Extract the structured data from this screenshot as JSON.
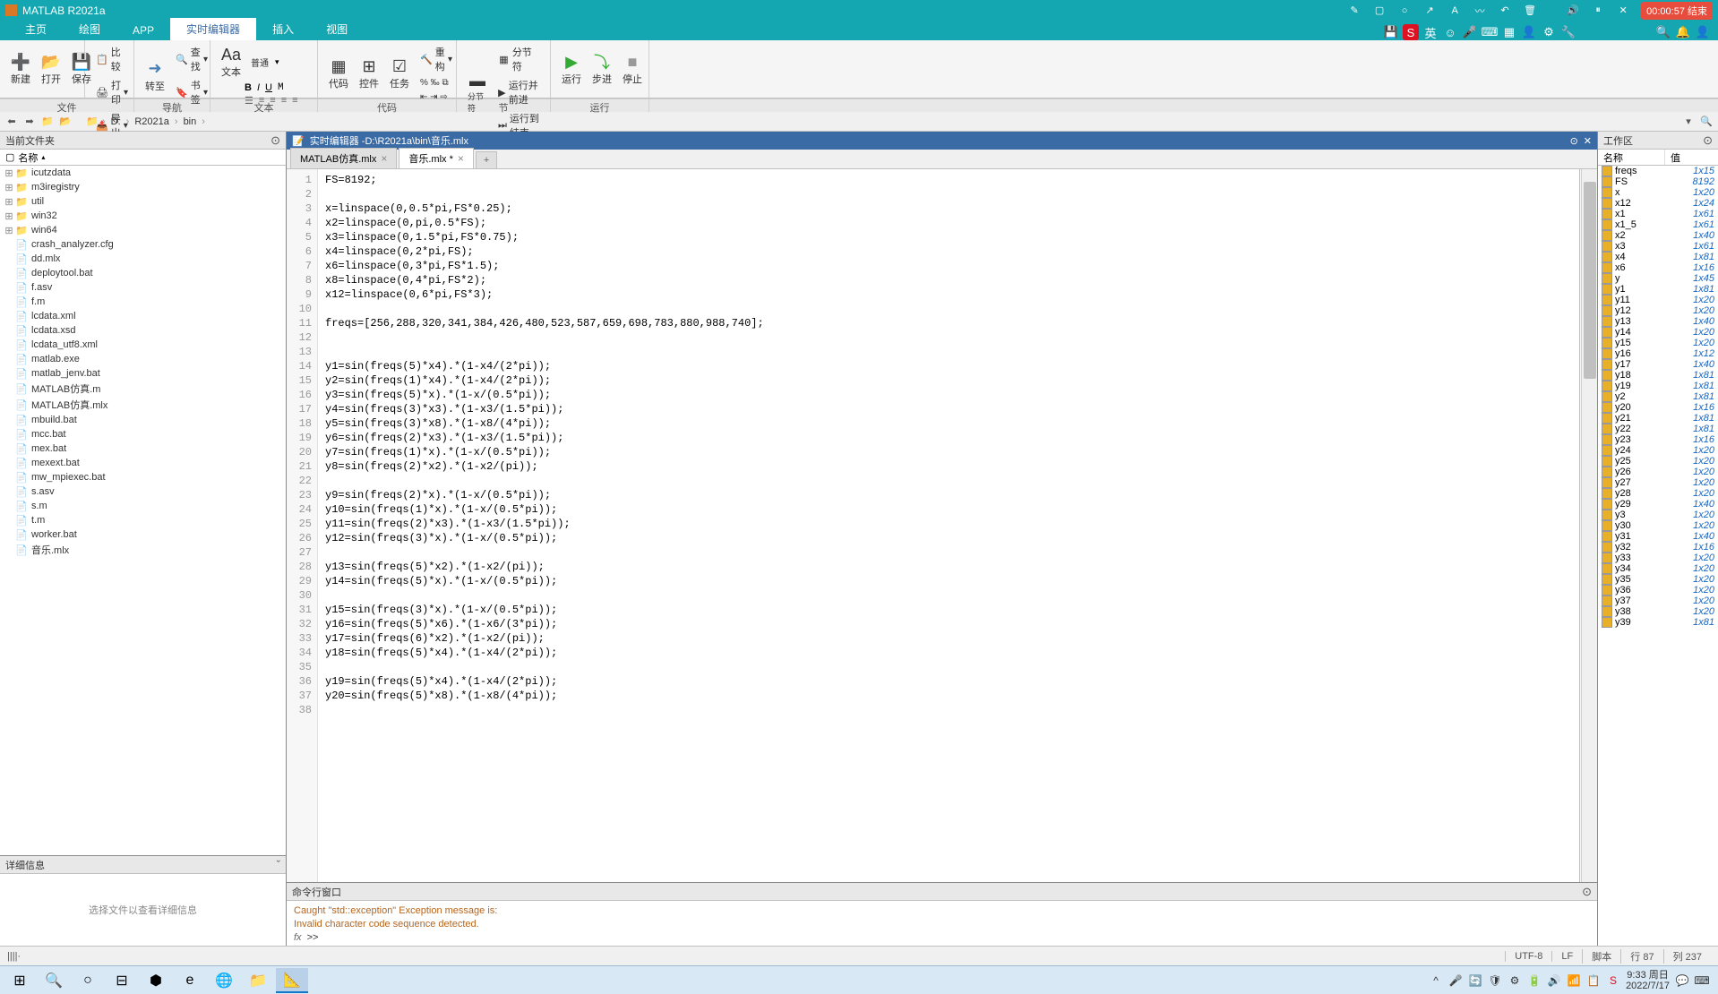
{
  "app": {
    "title": "MATLAB R2021a",
    "timer": "00:00:57 结束"
  },
  "tabs": {
    "home": "主页",
    "plots": "绘图",
    "app": "APP",
    "editor": "实时编辑器",
    "insert": "插入",
    "view": "视图"
  },
  "toolstrip": {
    "new": "新建",
    "open": "打开",
    "save": "保存",
    "compare": "比较",
    "print": "打印",
    "export": "导出",
    "goto": "转至",
    "find": "查找",
    "bookmark": "书签",
    "normal": "普通",
    "text": "文本",
    "refactor": "重构",
    "code": "代码",
    "control": "控件",
    "task": "任务",
    "section": "分节符",
    "run_parallel": "运行并前进",
    "run_to_end": "运行到结束",
    "run": "运行",
    "step": "步进",
    "stop": "停止",
    "grp_file": "文件",
    "grp_nav": "导航",
    "grp_text": "文本",
    "grp_code": "代码",
    "grp_section": "节",
    "grp_run": "运行"
  },
  "path": {
    "drive": "D:",
    "p1": "R2021a",
    "p2": "bin"
  },
  "panels": {
    "current_folder": "当前文件夹",
    "name_col": "名称",
    "details": "详细信息",
    "details_hint": "选择文件以查看详细信息",
    "workspace": "工作区",
    "ws_name": "名称",
    "ws_value": "值",
    "command": "命令行窗口"
  },
  "files": [
    {
      "n": "icutzdata",
      "t": "folder",
      "e": true
    },
    {
      "n": "m3iregistry",
      "t": "folder",
      "e": true
    },
    {
      "n": "util",
      "t": "folder",
      "e": true
    },
    {
      "n": "win32",
      "t": "folder",
      "e": true
    },
    {
      "n": "win64",
      "t": "folder",
      "e": true
    },
    {
      "n": "crash_analyzer.cfg",
      "t": "file"
    },
    {
      "n": "dd.mlx",
      "t": "file"
    },
    {
      "n": "deploytool.bat",
      "t": "file"
    },
    {
      "n": "f.asv",
      "t": "file"
    },
    {
      "n": "f.m",
      "t": "file"
    },
    {
      "n": "lcdata.xml",
      "t": "file"
    },
    {
      "n": "lcdata.xsd",
      "t": "file"
    },
    {
      "n": "lcdata_utf8.xml",
      "t": "file"
    },
    {
      "n": "matlab.exe",
      "t": "file"
    },
    {
      "n": "matlab_jenv.bat",
      "t": "file"
    },
    {
      "n": "MATLAB仿真.m",
      "t": "file"
    },
    {
      "n": "MATLAB仿真.mlx",
      "t": "file"
    },
    {
      "n": "mbuild.bat",
      "t": "file"
    },
    {
      "n": "mcc.bat",
      "t": "file"
    },
    {
      "n": "mex.bat",
      "t": "file"
    },
    {
      "n": "mexext.bat",
      "t": "file"
    },
    {
      "n": "mw_mpiexec.bat",
      "t": "file"
    },
    {
      "n": "s.asv",
      "t": "file"
    },
    {
      "n": "s.m",
      "t": "file"
    },
    {
      "n": "t.m",
      "t": "file"
    },
    {
      "n": "worker.bat",
      "t": "file"
    },
    {
      "n": "音乐.mlx",
      "t": "file"
    }
  ],
  "editor": {
    "title_prefix": "实时编辑器 - ",
    "title_path": "D:\\R2021a\\bin\\音乐.mlx",
    "tab1": "MATLAB仿真.mlx",
    "tab2": "音乐.mlx *",
    "lines": [
      "FS=8192;",
      "",
      "x=linspace(0,0.5*pi,FS*0.25);",
      "x2=linspace(0,pi,0.5*FS);",
      "x3=linspace(0,1.5*pi,FS*0.75);",
      "x4=linspace(0,2*pi,FS);",
      "x6=linspace(0,3*pi,FS*1.5);",
      "x8=linspace(0,4*pi,FS*2);",
      "x12=linspace(0,6*pi,FS*3);",
      "",
      "freqs=[256,288,320,341,384,426,480,523,587,659,698,783,880,988,740];",
      "",
      "",
      "y1=sin(freqs(5)*x4).*(1-x4/(2*pi));",
      "y2=sin(freqs(1)*x4).*(1-x4/(2*pi));",
      "y3=sin(freqs(5)*x).*(1-x/(0.5*pi));",
      "y4=sin(freqs(3)*x3).*(1-x3/(1.5*pi));",
      "y5=sin(freqs(3)*x8).*(1-x8/(4*pi));",
      "y6=sin(freqs(2)*x3).*(1-x3/(1.5*pi));",
      "y7=sin(freqs(1)*x).*(1-x/(0.5*pi));",
      "y8=sin(freqs(2)*x2).*(1-x2/(pi));",
      "",
      "y9=sin(freqs(2)*x).*(1-x/(0.5*pi));",
      "y10=sin(freqs(1)*x).*(1-x/(0.5*pi));",
      "y11=sin(freqs(2)*x3).*(1-x3/(1.5*pi));",
      "y12=sin(freqs(3)*x).*(1-x/(0.5*pi));",
      "",
      "y13=sin(freqs(5)*x2).*(1-x2/(pi));",
      "y14=sin(freqs(5)*x).*(1-x/(0.5*pi));",
      "",
      "y15=sin(freqs(3)*x).*(1-x/(0.5*pi));",
      "y16=sin(freqs(5)*x6).*(1-x6/(3*pi));",
      "y17=sin(freqs(6)*x2).*(1-x2/(pi));",
      "y18=sin(freqs(5)*x4).*(1-x4/(2*pi));",
      "",
      "y19=sin(freqs(5)*x4).*(1-x4/(2*pi));",
      "y20=sin(freqs(5)*x8).*(1-x8/(4*pi));",
      ""
    ]
  },
  "cmd": {
    "line1": "Caught \"std::exception\" Exception message is:",
    "line2": "Invalid character code sequence detected.",
    "prompt": ">>"
  },
  "workspace": [
    {
      "n": "freqs",
      "v": "1x15"
    },
    {
      "n": "FS",
      "v": "8192"
    },
    {
      "n": "x",
      "v": "1x20"
    },
    {
      "n": "x12",
      "v": "1x24"
    },
    {
      "n": "x1",
      "v": "1x61"
    },
    {
      "n": "x1_5",
      "v": "1x61"
    },
    {
      "n": "x2",
      "v": "1x40"
    },
    {
      "n": "x3",
      "v": "1x61"
    },
    {
      "n": "x4",
      "v": "1x81"
    },
    {
      "n": "x6",
      "v": "1x16"
    },
    {
      "n": "y",
      "v": "1x45"
    },
    {
      "n": "y1",
      "v": "1x81"
    },
    {
      "n": "y11",
      "v": "1x20"
    },
    {
      "n": "y12",
      "v": "1x20"
    },
    {
      "n": "y13",
      "v": "1x40"
    },
    {
      "n": "y14",
      "v": "1x20"
    },
    {
      "n": "y15",
      "v": "1x20"
    },
    {
      "n": "y16",
      "v": "1x12"
    },
    {
      "n": "y17",
      "v": "1x40"
    },
    {
      "n": "y18",
      "v": "1x81"
    },
    {
      "n": "y19",
      "v": "1x81"
    },
    {
      "n": "y2",
      "v": "1x81"
    },
    {
      "n": "y20",
      "v": "1x16"
    },
    {
      "n": "y21",
      "v": "1x81"
    },
    {
      "n": "y22",
      "v": "1x81"
    },
    {
      "n": "y23",
      "v": "1x16"
    },
    {
      "n": "y24",
      "v": "1x20"
    },
    {
      "n": "y25",
      "v": "1x20"
    },
    {
      "n": "y26",
      "v": "1x20"
    },
    {
      "n": "y27",
      "v": "1x20"
    },
    {
      "n": "y28",
      "v": "1x20"
    },
    {
      "n": "y29",
      "v": "1x40"
    },
    {
      "n": "y3",
      "v": "1x20"
    },
    {
      "n": "y30",
      "v": "1x20"
    },
    {
      "n": "y31",
      "v": "1x40"
    },
    {
      "n": "y32",
      "v": "1x16"
    },
    {
      "n": "y33",
      "v": "1x20"
    },
    {
      "n": "y34",
      "v": "1x20"
    },
    {
      "n": "y35",
      "v": "1x20"
    },
    {
      "n": "y36",
      "v": "1x20"
    },
    {
      "n": "y37",
      "v": "1x20"
    },
    {
      "n": "y38",
      "v": "1x20"
    },
    {
      "n": "y39",
      "v": "1x81"
    }
  ],
  "status": {
    "encoding": "UTF-8",
    "eol": "LF",
    "mode": "脚本",
    "line_lbl": "行",
    "line": "87",
    "col_lbl": "列",
    "col": "237"
  },
  "taskbar": {
    "time": "9:33 周日",
    "date": "2022/7/17",
    "ime": "英"
  }
}
